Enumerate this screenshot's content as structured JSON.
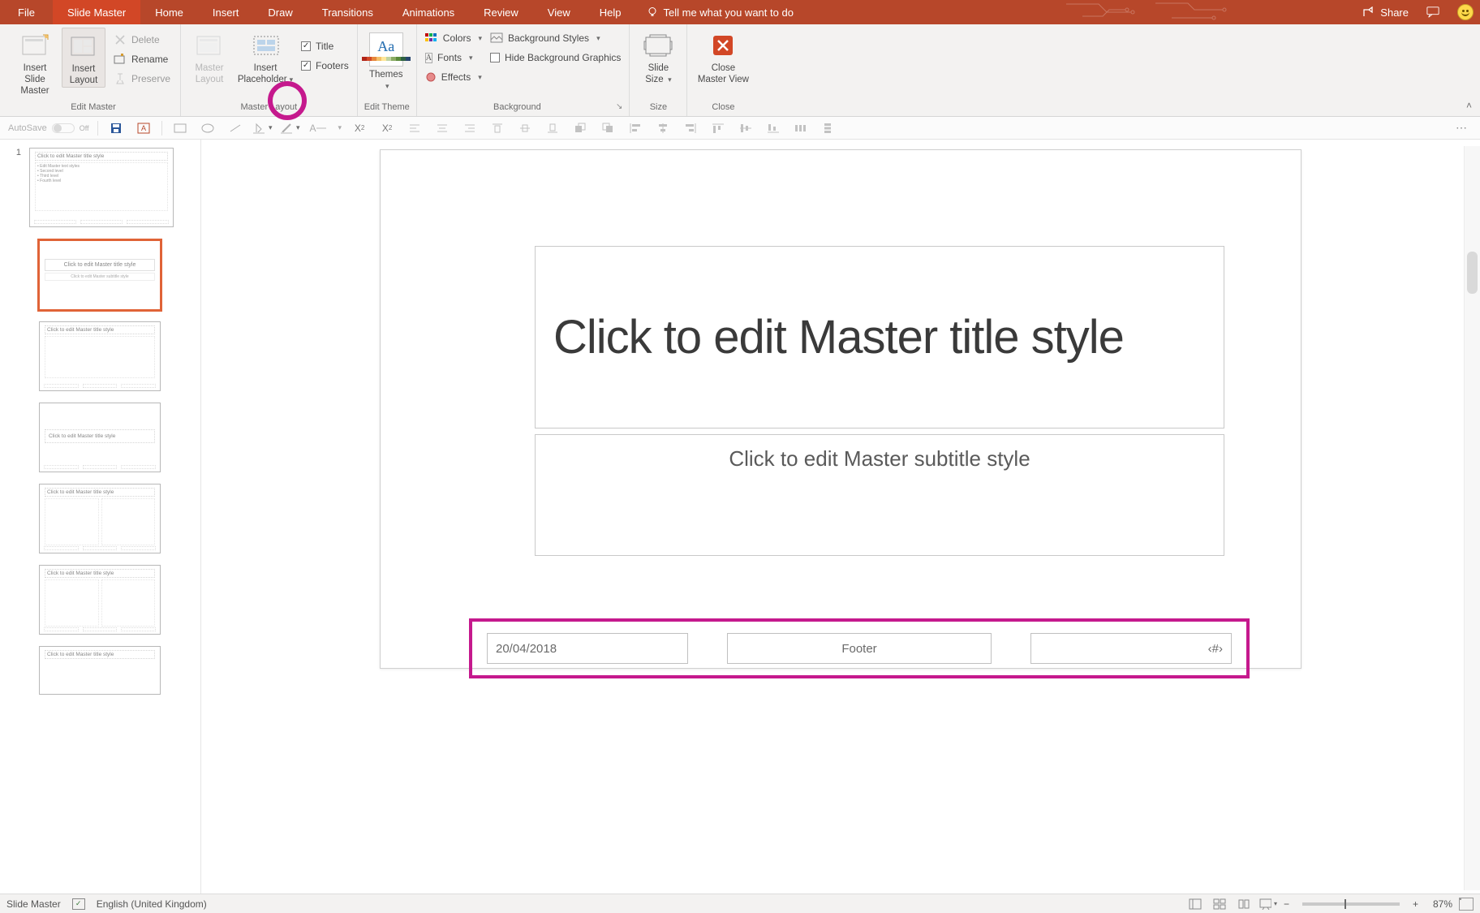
{
  "tabs": {
    "file": "File",
    "slide_master": "Slide Master",
    "home": "Home",
    "insert": "Insert",
    "draw": "Draw",
    "transitions": "Transitions",
    "animations": "Animations",
    "review": "Review",
    "view": "View",
    "help": "Help",
    "tell_me": "Tell me what you want to do"
  },
  "titlebar": {
    "share": "Share"
  },
  "ribbon": {
    "edit_master": {
      "label": "Edit Master",
      "insert_slide_master": "Insert Slide\nMaster",
      "insert_layout": "Insert\nLayout",
      "delete": "Delete",
      "rename": "Rename",
      "preserve": "Preserve"
    },
    "master_layout": {
      "label": "Master Layout",
      "master_layout_btn": "Master\nLayout",
      "insert_placeholder": "Insert\nPlaceholder",
      "title_check": "Title",
      "footers_check": "Footers"
    },
    "edit_theme": {
      "label": "Edit Theme",
      "themes": "Themes"
    },
    "background": {
      "label": "Background",
      "colors": "Colors",
      "fonts": "Fonts",
      "effects": "Effects",
      "bg_styles": "Background Styles",
      "hide_bg": "Hide Background Graphics"
    },
    "size": {
      "label": "Size",
      "slide_size": "Slide\nSize"
    },
    "close": {
      "label": "Close",
      "close_master": "Close\nMaster View"
    },
    "swatch_colors": [
      "#b02418",
      "#d24726",
      "#e6873c",
      "#f2c069",
      "#ffe699",
      "#bfd3a1",
      "#8aab63",
      "#5a8a3a",
      "#2e6142",
      "#26456e"
    ]
  },
  "qa": {
    "autosave": "AutoSave",
    "off": "Off"
  },
  "thumbs": {
    "num": "1",
    "t_click_title": "Click to edit Master title style",
    "t_bullets": "• Edit Master text styles\n  • Second level\n    • Third level\n      • Fourth level",
    "t_sub": "Click to edit Master subtitle style"
  },
  "slide": {
    "title_ph": "Click to edit Master title style",
    "subtitle_ph": "Click to edit Master subtitle style",
    "footer_date": "20/04/2018",
    "footer_center": "Footer",
    "footer_page": "‹#›"
  },
  "status": {
    "mode": "Slide Master",
    "lang": "English (United Kingdom)",
    "zoom": "87%"
  }
}
